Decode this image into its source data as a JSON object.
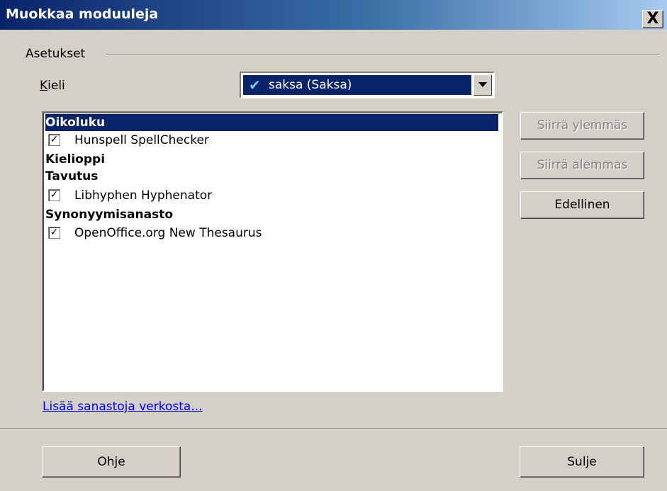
{
  "window": {
    "title": "Muokkaa moduuleja",
    "close_glyph": "X"
  },
  "settings": {
    "group_label": "Asetukset",
    "language": {
      "label": "Kieli",
      "selected_value": "saksa (Saksa)",
      "check_icon": "check-icon"
    }
  },
  "modules": [
    {
      "type": "header",
      "label": "Oikoluku",
      "selected": true
    },
    {
      "type": "item",
      "label": "Hunspell SpellChecker",
      "checked": true
    },
    {
      "type": "header",
      "label": "Kielioppi"
    },
    {
      "type": "header",
      "label": "Tavutus"
    },
    {
      "type": "item",
      "label": "Libhyphen Hyphenator",
      "checked": true
    },
    {
      "type": "header",
      "label": "Synonyymisanasto"
    },
    {
      "type": "item",
      "label": "OpenOffice.org New Thesaurus",
      "checked": true
    }
  ],
  "side_buttons": {
    "move_up": "Siirrä ylemmäs",
    "move_down": "Siirrä alemmas",
    "back": "Edellinen"
  },
  "link": {
    "more_dictionaries": "Lisää sanastoja verkosta..."
  },
  "footer": {
    "help": "Ohje",
    "close": "Sulje"
  },
  "colors": {
    "title_start": "#0a246a",
    "title_end": "#a6caf0",
    "selection": "#0a246a",
    "dialog_bg": "#d4d0c8",
    "link": "#0000ff"
  }
}
